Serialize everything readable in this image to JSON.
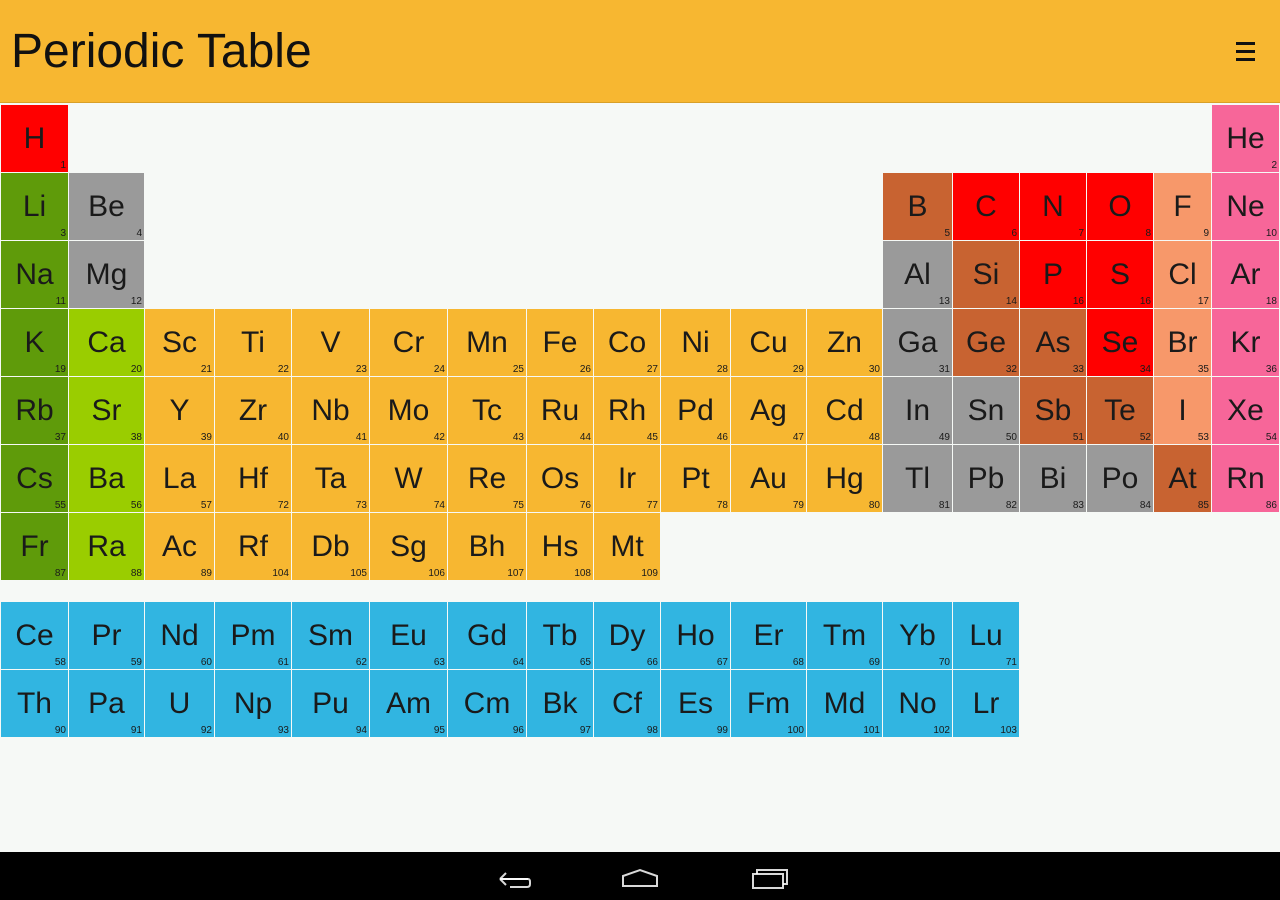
{
  "app": {
    "title": "Periodic Table",
    "menu_icon": "hamburger-menu-icon"
  },
  "colors": {
    "alkali": "#5f9b0a",
    "alkaline": "#9acd00",
    "transition": "#f7b731",
    "post_transition": "#9a9a9a",
    "metalloid": "#c86331",
    "nonmetal": "#ff0000",
    "halogen": "#f7986a",
    "noble": "#f76699",
    "lanthanide": "#31b5e1",
    "actinide": "#31b5e1"
  },
  "elements": [
    {
      "symbol": "H",
      "number": 1,
      "row": 1,
      "col": 1,
      "group": "nonmetal"
    },
    {
      "symbol": "He",
      "number": 2,
      "row": 1,
      "col": 18,
      "group": "noble"
    },
    {
      "symbol": "Li",
      "number": 3,
      "row": 2,
      "col": 1,
      "group": "alkali"
    },
    {
      "symbol": "Be",
      "number": 4,
      "row": 2,
      "col": 2,
      "group": "post_transition"
    },
    {
      "symbol": "B",
      "number": 5,
      "row": 2,
      "col": 13,
      "group": "metalloid"
    },
    {
      "symbol": "C",
      "number": 6,
      "row": 2,
      "col": 14,
      "group": "nonmetal"
    },
    {
      "symbol": "N",
      "number": 7,
      "row": 2,
      "col": 15,
      "group": "nonmetal"
    },
    {
      "symbol": "O",
      "number": 8,
      "row": 2,
      "col": 16,
      "group": "nonmetal"
    },
    {
      "symbol": "F",
      "number": 9,
      "row": 2,
      "col": 17,
      "group": "halogen"
    },
    {
      "symbol": "Ne",
      "number": 10,
      "row": 2,
      "col": 18,
      "group": "noble"
    },
    {
      "symbol": "Na",
      "number": 11,
      "row": 3,
      "col": 1,
      "group": "alkali"
    },
    {
      "symbol": "Mg",
      "number": 12,
      "row": 3,
      "col": 2,
      "group": "post_transition"
    },
    {
      "symbol": "Al",
      "number": 13,
      "row": 3,
      "col": 13,
      "group": "post_transition"
    },
    {
      "symbol": "Si",
      "number": 14,
      "row": 3,
      "col": 14,
      "group": "metalloid"
    },
    {
      "symbol": "P",
      "number": 16,
      "row": 3,
      "col": 15,
      "group": "nonmetal"
    },
    {
      "symbol": "S",
      "number": 16,
      "row": 3,
      "col": 16,
      "group": "nonmetal"
    },
    {
      "symbol": "Cl",
      "number": 17,
      "row": 3,
      "col": 17,
      "group": "halogen"
    },
    {
      "symbol": "Ar",
      "number": 18,
      "row": 3,
      "col": 18,
      "group": "noble"
    },
    {
      "symbol": "K",
      "number": 19,
      "row": 4,
      "col": 1,
      "group": "alkali"
    },
    {
      "symbol": "Ca",
      "number": 20,
      "row": 4,
      "col": 2,
      "group": "alkaline"
    },
    {
      "symbol": "Sc",
      "number": 21,
      "row": 4,
      "col": 3,
      "group": "transition"
    },
    {
      "symbol": "Ti",
      "number": 22,
      "row": 4,
      "col": 4,
      "group": "transition"
    },
    {
      "symbol": "V",
      "number": 23,
      "row": 4,
      "col": 5,
      "group": "transition"
    },
    {
      "symbol": "Cr",
      "number": 24,
      "row": 4,
      "col": 6,
      "group": "transition"
    },
    {
      "symbol": "Mn",
      "number": 25,
      "row": 4,
      "col": 7,
      "group": "transition"
    },
    {
      "symbol": "Fe",
      "number": 26,
      "row": 4,
      "col": 8,
      "group": "transition"
    },
    {
      "symbol": "Co",
      "number": 27,
      "row": 4,
      "col": 9,
      "group": "transition"
    },
    {
      "symbol": "Ni",
      "number": 28,
      "row": 4,
      "col": 10,
      "group": "transition"
    },
    {
      "symbol": "Cu",
      "number": 29,
      "row": 4,
      "col": 11,
      "group": "transition"
    },
    {
      "symbol": "Zn",
      "number": 30,
      "row": 4,
      "col": 12,
      "group": "transition"
    },
    {
      "symbol": "Ga",
      "number": 31,
      "row": 4,
      "col": 13,
      "group": "post_transition"
    },
    {
      "symbol": "Ge",
      "number": 32,
      "row": 4,
      "col": 14,
      "group": "metalloid"
    },
    {
      "symbol": "As",
      "number": 33,
      "row": 4,
      "col": 15,
      "group": "metalloid"
    },
    {
      "symbol": "Se",
      "number": 34,
      "row": 4,
      "col": 16,
      "group": "nonmetal"
    },
    {
      "symbol": "Br",
      "number": 35,
      "row": 4,
      "col": 17,
      "group": "halogen"
    },
    {
      "symbol": "Kr",
      "number": 36,
      "row": 4,
      "col": 18,
      "group": "noble"
    },
    {
      "symbol": "Rb",
      "number": 37,
      "row": 5,
      "col": 1,
      "group": "alkali"
    },
    {
      "symbol": "Sr",
      "number": 38,
      "row": 5,
      "col": 2,
      "group": "alkaline"
    },
    {
      "symbol": "Y",
      "number": 39,
      "row": 5,
      "col": 3,
      "group": "transition"
    },
    {
      "symbol": "Zr",
      "number": 40,
      "row": 5,
      "col": 4,
      "group": "transition"
    },
    {
      "symbol": "Nb",
      "number": 41,
      "row": 5,
      "col": 5,
      "group": "transition"
    },
    {
      "symbol": "Mo",
      "number": 42,
      "row": 5,
      "col": 6,
      "group": "transition"
    },
    {
      "symbol": "Tc",
      "number": 43,
      "row": 5,
      "col": 7,
      "group": "transition"
    },
    {
      "symbol": "Ru",
      "number": 44,
      "row": 5,
      "col": 8,
      "group": "transition"
    },
    {
      "symbol": "Rh",
      "number": 45,
      "row": 5,
      "col": 9,
      "group": "transition"
    },
    {
      "symbol": "Pd",
      "number": 46,
      "row": 5,
      "col": 10,
      "group": "transition"
    },
    {
      "symbol": "Ag",
      "number": 47,
      "row": 5,
      "col": 11,
      "group": "transition"
    },
    {
      "symbol": "Cd",
      "number": 48,
      "row": 5,
      "col": 12,
      "group": "transition"
    },
    {
      "symbol": "In",
      "number": 49,
      "row": 5,
      "col": 13,
      "group": "post_transition"
    },
    {
      "symbol": "Sn",
      "number": 50,
      "row": 5,
      "col": 14,
      "group": "post_transition"
    },
    {
      "symbol": "Sb",
      "number": 51,
      "row": 5,
      "col": 15,
      "group": "metalloid"
    },
    {
      "symbol": "Te",
      "number": 52,
      "row": 5,
      "col": 16,
      "group": "metalloid"
    },
    {
      "symbol": "I",
      "number": 53,
      "row": 5,
      "col": 17,
      "group": "halogen"
    },
    {
      "symbol": "Xe",
      "number": 54,
      "row": 5,
      "col": 18,
      "group": "noble"
    },
    {
      "symbol": "Cs",
      "number": 55,
      "row": 6,
      "col": 1,
      "group": "alkali"
    },
    {
      "symbol": "Ba",
      "number": 56,
      "row": 6,
      "col": 2,
      "group": "alkaline"
    },
    {
      "symbol": "La",
      "number": 57,
      "row": 6,
      "col": 3,
      "group": "transition"
    },
    {
      "symbol": "Hf",
      "number": 72,
      "row": 6,
      "col": 4,
      "group": "transition"
    },
    {
      "symbol": "Ta",
      "number": 73,
      "row": 6,
      "col": 5,
      "group": "transition"
    },
    {
      "symbol": "W",
      "number": 74,
      "row": 6,
      "col": 6,
      "group": "transition"
    },
    {
      "symbol": "Re",
      "number": 75,
      "row": 6,
      "col": 7,
      "group": "transition"
    },
    {
      "symbol": "Os",
      "number": 76,
      "row": 6,
      "col": 8,
      "group": "transition"
    },
    {
      "symbol": "Ir",
      "number": 77,
      "row": 6,
      "col": 9,
      "group": "transition"
    },
    {
      "symbol": "Pt",
      "number": 78,
      "row": 6,
      "col": 10,
      "group": "transition"
    },
    {
      "symbol": "Au",
      "number": 79,
      "row": 6,
      "col": 11,
      "group": "transition"
    },
    {
      "symbol": "Hg",
      "number": 80,
      "row": 6,
      "col": 12,
      "group": "transition"
    },
    {
      "symbol": "Tl",
      "number": 81,
      "row": 6,
      "col": 13,
      "group": "post_transition"
    },
    {
      "symbol": "Pb",
      "number": 82,
      "row": 6,
      "col": 14,
      "group": "post_transition"
    },
    {
      "symbol": "Bi",
      "number": 83,
      "row": 6,
      "col": 15,
      "group": "post_transition"
    },
    {
      "symbol": "Po",
      "number": 84,
      "row": 6,
      "col": 16,
      "group": "post_transition"
    },
    {
      "symbol": "At",
      "number": 85,
      "row": 6,
      "col": 17,
      "group": "metalloid"
    },
    {
      "symbol": "Rn",
      "number": 86,
      "row": 6,
      "col": 18,
      "group": "noble"
    },
    {
      "symbol": "Fr",
      "number": 87,
      "row": 7,
      "col": 1,
      "group": "alkali"
    },
    {
      "symbol": "Ra",
      "number": 88,
      "row": 7,
      "col": 2,
      "group": "alkaline"
    },
    {
      "symbol": "Ac",
      "number": 89,
      "row": 7,
      "col": 3,
      "group": "transition"
    },
    {
      "symbol": "Rf",
      "number": 104,
      "row": 7,
      "col": 4,
      "group": "transition"
    },
    {
      "symbol": "Db",
      "number": 105,
      "row": 7,
      "col": 5,
      "group": "transition"
    },
    {
      "symbol": "Sg",
      "number": 106,
      "row": 7,
      "col": 6,
      "group": "transition"
    },
    {
      "symbol": "Bh",
      "number": 107,
      "row": 7,
      "col": 7,
      "group": "transition"
    },
    {
      "symbol": "Hs",
      "number": 108,
      "row": 7,
      "col": 8,
      "group": "transition"
    },
    {
      "symbol": "Mt",
      "number": 109,
      "row": 7,
      "col": 9,
      "group": "transition"
    },
    {
      "symbol": "Ce",
      "number": 58,
      "row": 8,
      "col": 1,
      "group": "lanthanide"
    },
    {
      "symbol": "Pr",
      "number": 59,
      "row": 8,
      "col": 2,
      "group": "lanthanide"
    },
    {
      "symbol": "Nd",
      "number": 60,
      "row": 8,
      "col": 3,
      "group": "lanthanide"
    },
    {
      "symbol": "Pm",
      "number": 61,
      "row": 8,
      "col": 4,
      "group": "lanthanide"
    },
    {
      "symbol": "Sm",
      "number": 62,
      "row": 8,
      "col": 5,
      "group": "lanthanide"
    },
    {
      "symbol": "Eu",
      "number": 63,
      "row": 8,
      "col": 6,
      "group": "lanthanide"
    },
    {
      "symbol": "Gd",
      "number": 64,
      "row": 8,
      "col": 7,
      "group": "lanthanide"
    },
    {
      "symbol": "Tb",
      "number": 65,
      "row": 8,
      "col": 8,
      "group": "lanthanide"
    },
    {
      "symbol": "Dy",
      "number": 66,
      "row": 8,
      "col": 9,
      "group": "lanthanide"
    },
    {
      "symbol": "Ho",
      "number": 67,
      "row": 8,
      "col": 10,
      "group": "lanthanide"
    },
    {
      "symbol": "Er",
      "number": 68,
      "row": 8,
      "col": 11,
      "group": "lanthanide"
    },
    {
      "symbol": "Tm",
      "number": 69,
      "row": 8,
      "col": 12,
      "group": "lanthanide"
    },
    {
      "symbol": "Yb",
      "number": 70,
      "row": 8,
      "col": 13,
      "group": "lanthanide"
    },
    {
      "symbol": "Lu",
      "number": 71,
      "row": 8,
      "col": 14,
      "group": "lanthanide"
    },
    {
      "symbol": "Th",
      "number": 90,
      "row": 9,
      "col": 1,
      "group": "actinide"
    },
    {
      "symbol": "Pa",
      "number": 91,
      "row": 9,
      "col": 2,
      "group": "actinide"
    },
    {
      "symbol": "U",
      "number": 92,
      "row": 9,
      "col": 3,
      "group": "actinide"
    },
    {
      "symbol": "Np",
      "number": 93,
      "row": 9,
      "col": 4,
      "group": "actinide"
    },
    {
      "symbol": "Pu",
      "number": 94,
      "row": 9,
      "col": 5,
      "group": "actinide"
    },
    {
      "symbol": "Am",
      "number": 95,
      "row": 9,
      "col": 6,
      "group": "actinide"
    },
    {
      "symbol": "Cm",
      "number": 96,
      "row": 9,
      "col": 7,
      "group": "actinide"
    },
    {
      "symbol": "Bk",
      "number": 97,
      "row": 9,
      "col": 8,
      "group": "actinide"
    },
    {
      "symbol": "Cf",
      "number": 98,
      "row": 9,
      "col": 9,
      "group": "actinide"
    },
    {
      "symbol": "Es",
      "number": 99,
      "row": 9,
      "col": 10,
      "group": "actinide"
    },
    {
      "symbol": "Fm",
      "number": 100,
      "row": 9,
      "col": 11,
      "group": "actinide"
    },
    {
      "symbol": "Md",
      "number": 101,
      "row": 9,
      "col": 12,
      "group": "actinide"
    },
    {
      "symbol": "No",
      "number": 102,
      "row": 9,
      "col": 13,
      "group": "actinide"
    },
    {
      "symbol": "Lr",
      "number": 103,
      "row": 9,
      "col": 14,
      "group": "actinide"
    }
  ],
  "navbar": {
    "buttons": [
      {
        "name": "back-icon"
      },
      {
        "name": "home-icon"
      },
      {
        "name": "recent-apps-icon"
      }
    ]
  }
}
